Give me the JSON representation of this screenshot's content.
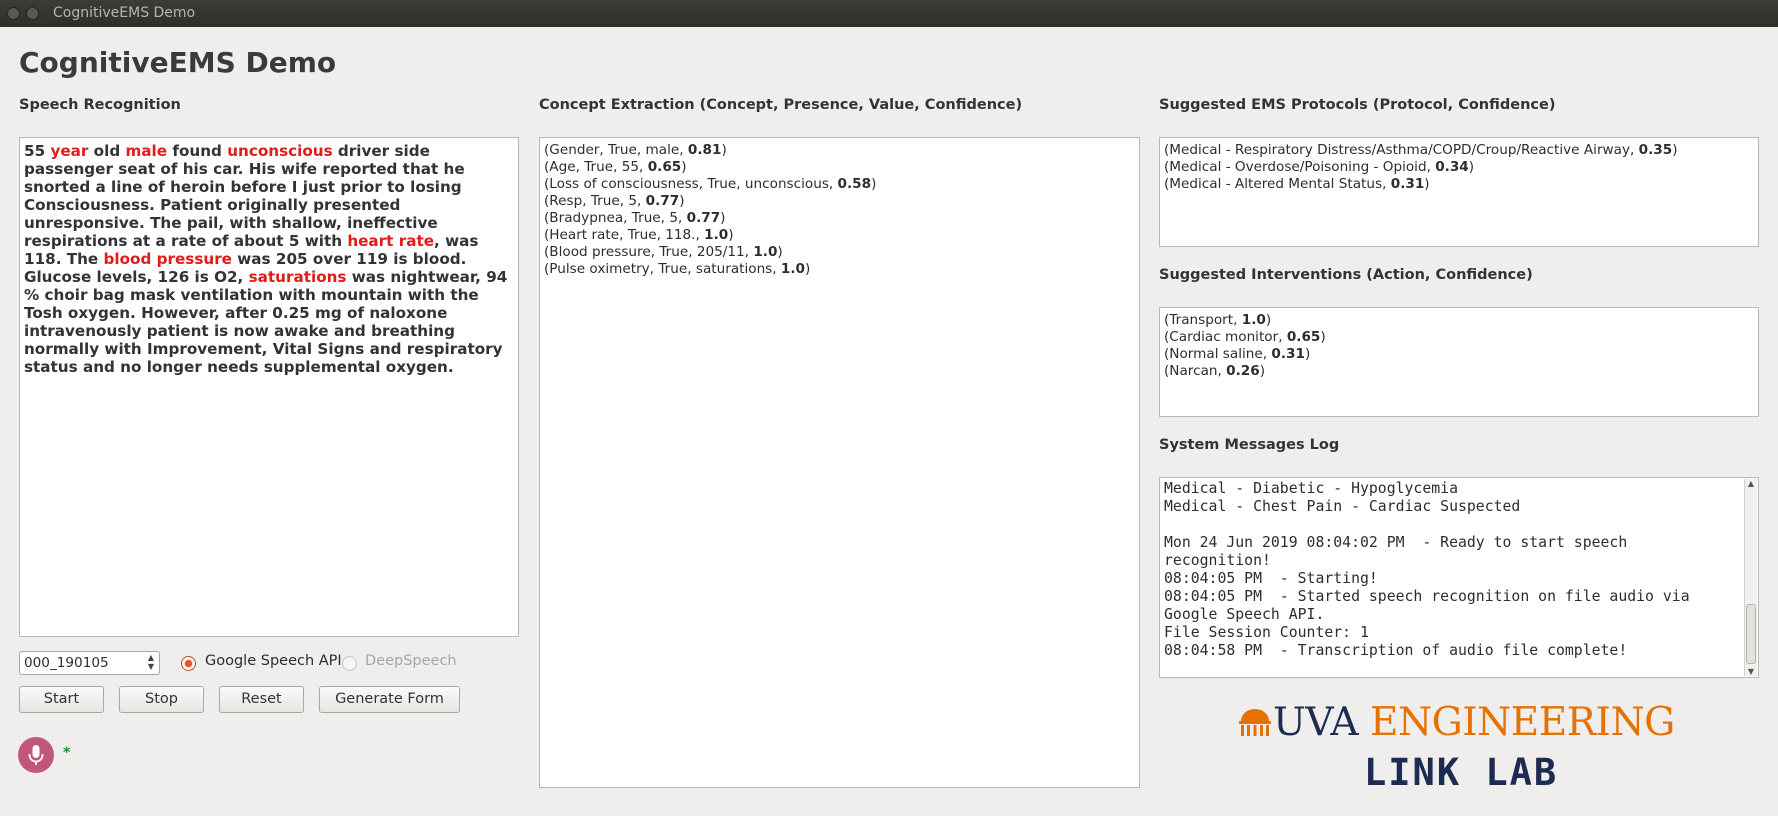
{
  "window": {
    "title": "CognitiveEMS Demo"
  },
  "app": {
    "title": "CognitiveEMS Demo"
  },
  "speech": {
    "label": "Speech Recognition",
    "segments": [
      {
        "t": "55 "
      },
      {
        "t": "year",
        "hl": true
      },
      {
        "t": " old "
      },
      {
        "t": "male",
        "hl": true
      },
      {
        "t": " found "
      },
      {
        "t": "unconscious",
        "hl": true
      },
      {
        "t": " driver side passenger seat of his car. His wife reported that he snorted a line of heroin before I just prior to losing Consciousness. Patient originally presented unresponsive. The pail, with shallow, ineffective respirations at a rate of about 5 with "
      },
      {
        "t": "heart rate",
        "hl": true
      },
      {
        "t": ", was 118. The "
      },
      {
        "t": "blood pressure",
        "hl": true
      },
      {
        "t": " was 205 over 119 is blood. Glucose levels, 126 is O2, "
      },
      {
        "t": "saturations",
        "hl": true
      },
      {
        "t": " was nightwear, 94 % choir bag mask ventilation with mountain with the Tosh oxygen. However, after 0.25 mg of naloxone intravenously patient is now awake and breathing normally with Improvement, Vital Signs and respiratory status and no longer needs supplemental oxygen."
      }
    ]
  },
  "concepts": {
    "label": "Concept Extraction (Concept, Presence, Value, Confidence)",
    "items": [
      {
        "text": "(Gender, True, male, ",
        "conf": "0.81"
      },
      {
        "text": "(Age, True, 55, ",
        "conf": "0.65"
      },
      {
        "text": "(Loss of consciousness, True, unconscious, ",
        "conf": "0.58"
      },
      {
        "text": "(Resp, True, 5, ",
        "conf": "0.77"
      },
      {
        "text": "(Bradypnea, True, 5, ",
        "conf": "0.77"
      },
      {
        "text": "(Heart rate, True, 118., ",
        "conf": "1.0"
      },
      {
        "text": "(Blood pressure, True, 205/11, ",
        "conf": "1.0"
      },
      {
        "text": "(Pulse oximetry, True, saturations, ",
        "conf": "1.0"
      }
    ]
  },
  "protocols": {
    "label": "Suggested EMS Protocols (Protocol, Confidence)",
    "items": [
      {
        "text": "(Medical - Respiratory Distress/Asthma/COPD/Croup/Reactive Airway, ",
        "conf": "0.35"
      },
      {
        "text": "(Medical - Overdose/Poisoning - Opioid, ",
        "conf": "0.34"
      },
      {
        "text": "(Medical - Altered Mental Status, ",
        "conf": "0.31"
      }
    ]
  },
  "interventions": {
    "label": "Suggested Interventions (Action, Confidence)",
    "items": [
      {
        "text": "(Transport, ",
        "conf": "1.0"
      },
      {
        "text": "(Cardiac monitor, ",
        "conf": "0.65"
      },
      {
        "text": "(Normal saline, ",
        "conf": "0.31"
      },
      {
        "text": "(Narcan, ",
        "conf": "0.26"
      }
    ]
  },
  "log": {
    "label": "System Messages Log",
    "text": "Medical - Diabetic - Hypoglycemia\nMedical - Chest Pain - Cardiac Suspected\n\nMon 24 Jun 2019 08:04:02 PM  - Ready to start speech recognition!\n08:04:05 PM  - Starting!\n08:04:05 PM  - Started speech recognition on file audio via Google Speech API.\nFile Session Counter: 1\n08:04:58 PM  - Transcription of audio file complete!"
  },
  "controls": {
    "file_value": "000_190105",
    "radio_google": "Google Speech API",
    "radio_deepspeech": "DeepSpeech",
    "start": "Start",
    "stop": "Stop",
    "reset": "Reset",
    "generate": "Generate Form",
    "status_star": "*"
  },
  "logo": {
    "uva": "UVA",
    "engineering": "ENGINEERING",
    "lab": "LINK LAB",
    "uva_color": "#1d2b53",
    "eng_color": "#e57200"
  }
}
